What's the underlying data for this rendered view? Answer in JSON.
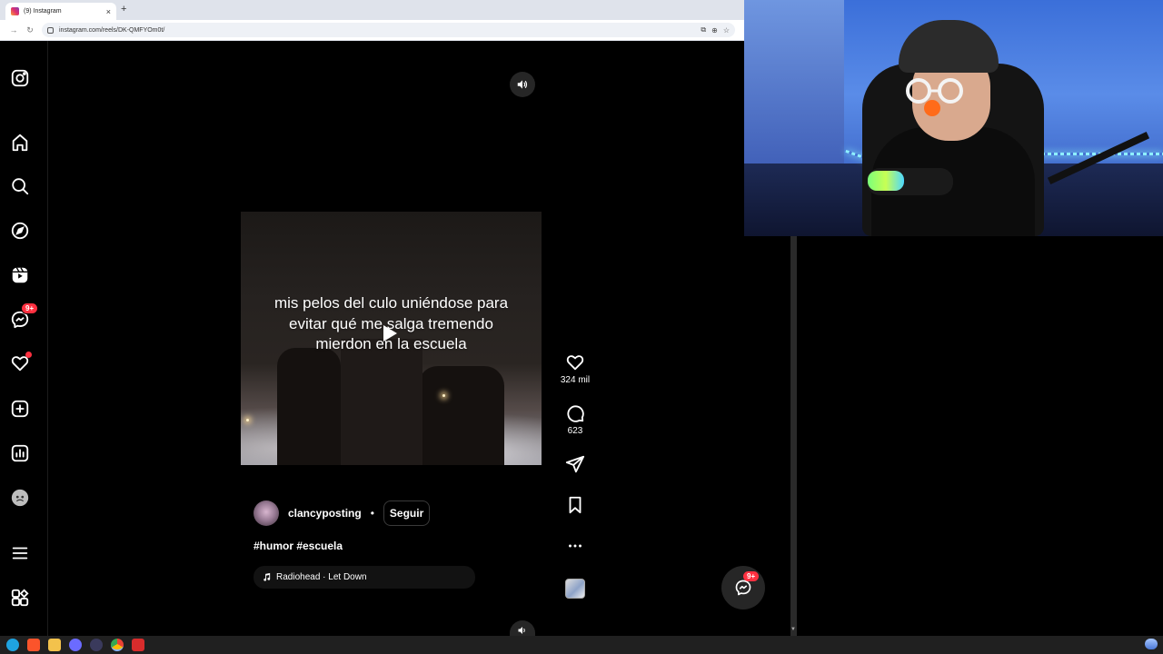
{
  "browser": {
    "tab_title": "(9) Instagram",
    "tab_close": "×",
    "new_tab": "+",
    "url": "instagram.com/reels/DK-QMFYOm0t/"
  },
  "sidebar": {
    "messages_badge": "9+",
    "items": [
      {
        "name": "instagram-logo-icon",
        "icon": "instagram"
      },
      {
        "name": "home-icon",
        "icon": "home"
      },
      {
        "name": "search-icon",
        "icon": "search"
      },
      {
        "name": "explore-icon",
        "icon": "compass"
      },
      {
        "name": "reels-icon",
        "icon": "reels"
      },
      {
        "name": "messages-icon",
        "icon": "messenger"
      },
      {
        "name": "notifications-icon",
        "icon": "heart"
      },
      {
        "name": "create-icon",
        "icon": "plus-square"
      },
      {
        "name": "dashboard-icon",
        "icon": "bar-chart"
      },
      {
        "name": "profile-avatar",
        "icon": "avatar"
      },
      {
        "name": "more-menu-icon",
        "icon": "hamburger"
      },
      {
        "name": "also-from-meta-icon",
        "icon": "grid"
      }
    ]
  },
  "reel": {
    "overlay_text": "mis pelos del culo uniéndose para evitar qué me salga tremendo mierdon en la escuela",
    "likes": "324 mil",
    "comments": "623",
    "username": "clancyposting",
    "separator": "•",
    "follow_label": "Seguir",
    "hashtags": "#humor #escuela",
    "audio": "Radiohead · Let Down"
  },
  "fab": {
    "badge": "9+"
  },
  "colors": {
    "accent_badge": "#ff3040",
    "background": "#000000",
    "chrome": "#dfe3eb"
  }
}
